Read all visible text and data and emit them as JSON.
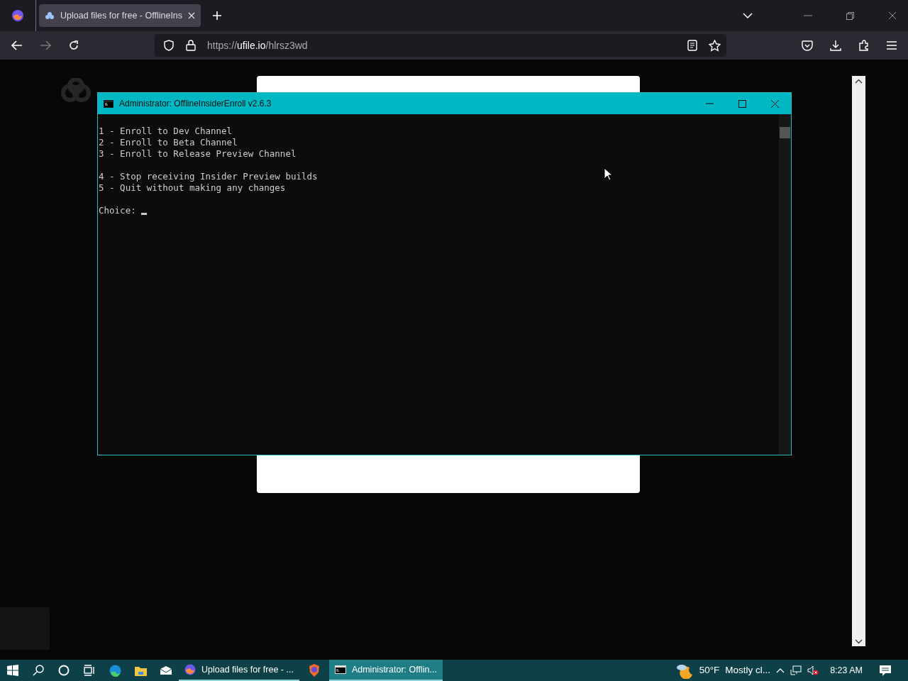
{
  "browser": {
    "tabs": [
      {
        "title": "Upload files for free - OfflineIns",
        "selected": true
      }
    ],
    "url": {
      "scheme": "https://",
      "host": "ufile.io",
      "path": "/hlrsz3wd"
    }
  },
  "console": {
    "title": "Administrator:  OfflineInsiderEnroll v2.6.3",
    "line_groups": [
      [
        "1 - Enroll to Dev Channel",
        "2 - Enroll to Beta Channel",
        "3 - Enroll to Release Preview Channel"
      ],
      [
        "4 - Stop receiving Insider Preview builds",
        "5 - Quit without making any changes"
      ]
    ],
    "prompt": "Choice: "
  },
  "taskbar": {
    "apps": [
      {
        "kind": "browser",
        "label": "Upload files for free - ...",
        "selected": false
      },
      {
        "kind": "console",
        "label": "Administrator:  Offlin...",
        "selected": true
      }
    ],
    "temperature": "50°F",
    "weather": "Mostly cl...",
    "time": "8:23 AM"
  }
}
